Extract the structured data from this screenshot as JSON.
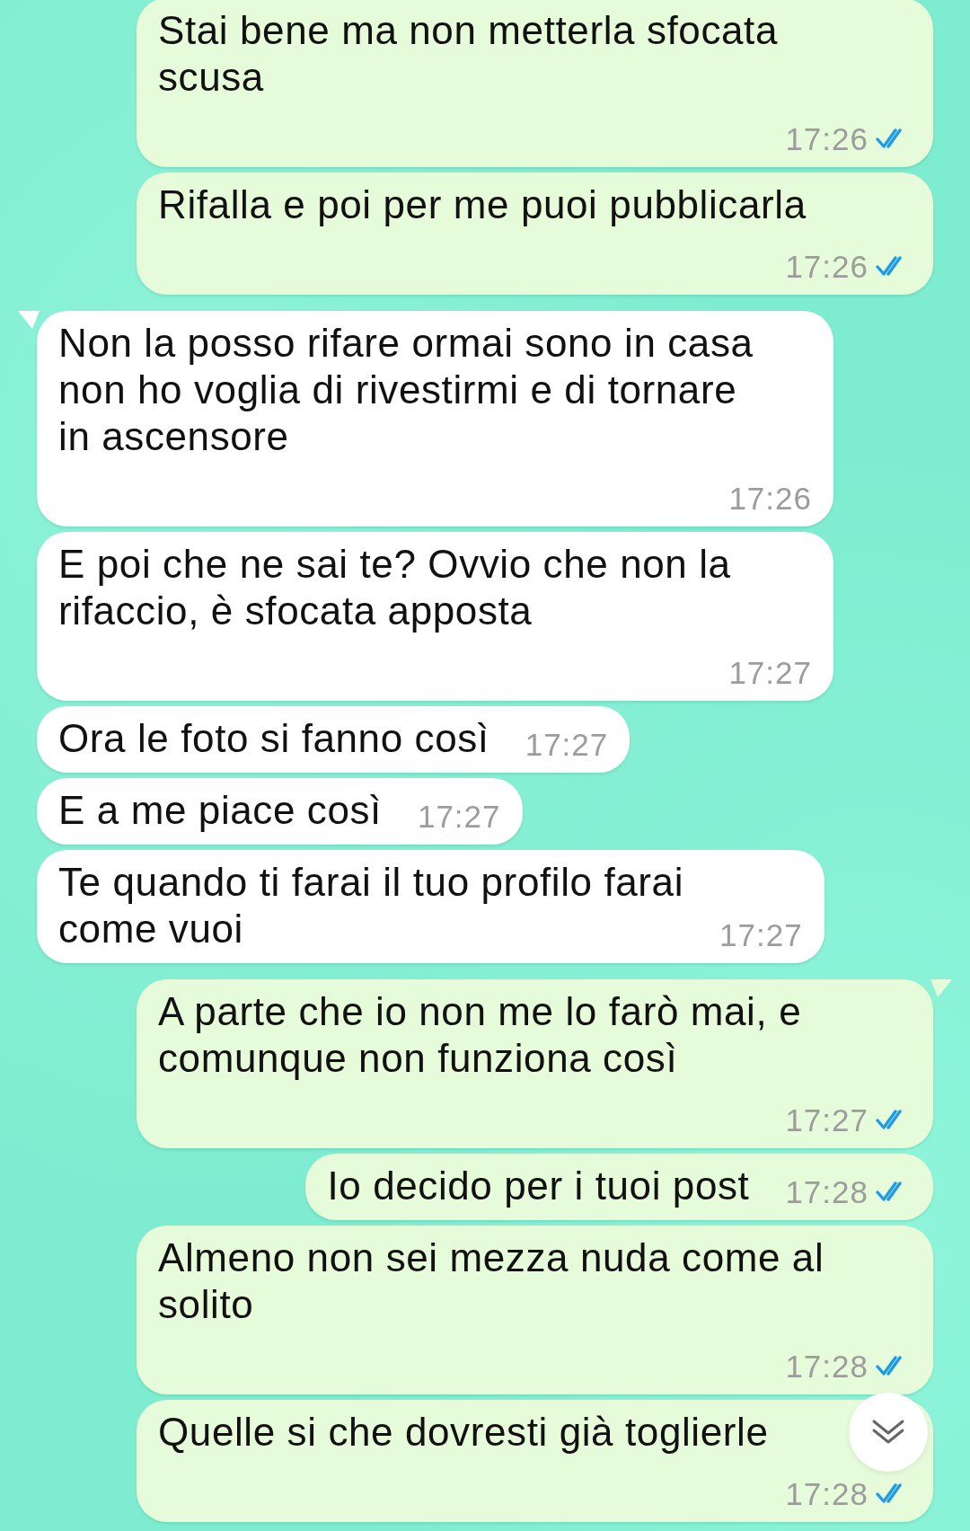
{
  "messages": [
    {
      "kind": "outgoing",
      "tail": false,
      "text": "Stai bene ma non metterla sfocata\nscusa",
      "time": "17:26",
      "read": true
    },
    {
      "kind": "outgoing",
      "tail": false,
      "text": "Rifalla e poi per me puoi pubblicarla",
      "time": "17:26",
      "read": true
    },
    {
      "kind": "incoming",
      "tail": true,
      "text": "Non la posso rifare ormai sono in casa\nnon ho voglia di rivestirmi e di tornare\nin ascensore",
      "time": "17:26"
    },
    {
      "kind": "incoming",
      "tail": false,
      "text": "E poi che ne sai te? Ovvio che non la\nrifaccio, è sfocata apposta",
      "time": "17:27"
    },
    {
      "kind": "incoming",
      "tail": false,
      "text": "Ora le foto si fanno così",
      "time": "17:27"
    },
    {
      "kind": "incoming",
      "tail": false,
      "text": "E a me piace così",
      "time": "17:27"
    },
    {
      "kind": "incoming",
      "tail": false,
      "text": "Te quando ti farai il tuo profilo farai\ncome vuoi",
      "time": "17:27"
    },
    {
      "kind": "outgoing",
      "tail": true,
      "text": "A parte che io non me lo farò mai, e\ncomunque non funziona così",
      "time": "17:27",
      "read": true
    },
    {
      "kind": "outgoing",
      "tail": false,
      "text": "Io decido per i tuoi post",
      "time": "17:28",
      "read": true
    },
    {
      "kind": "outgoing",
      "tail": false,
      "text": "Almeno non sei mezza nuda come al\nsolito",
      "time": "17:28",
      "read": true
    },
    {
      "kind": "outgoing",
      "tail": false,
      "text": "Quelle si che dovresti già toglierle",
      "time": "17:28",
      "read": true
    }
  ]
}
